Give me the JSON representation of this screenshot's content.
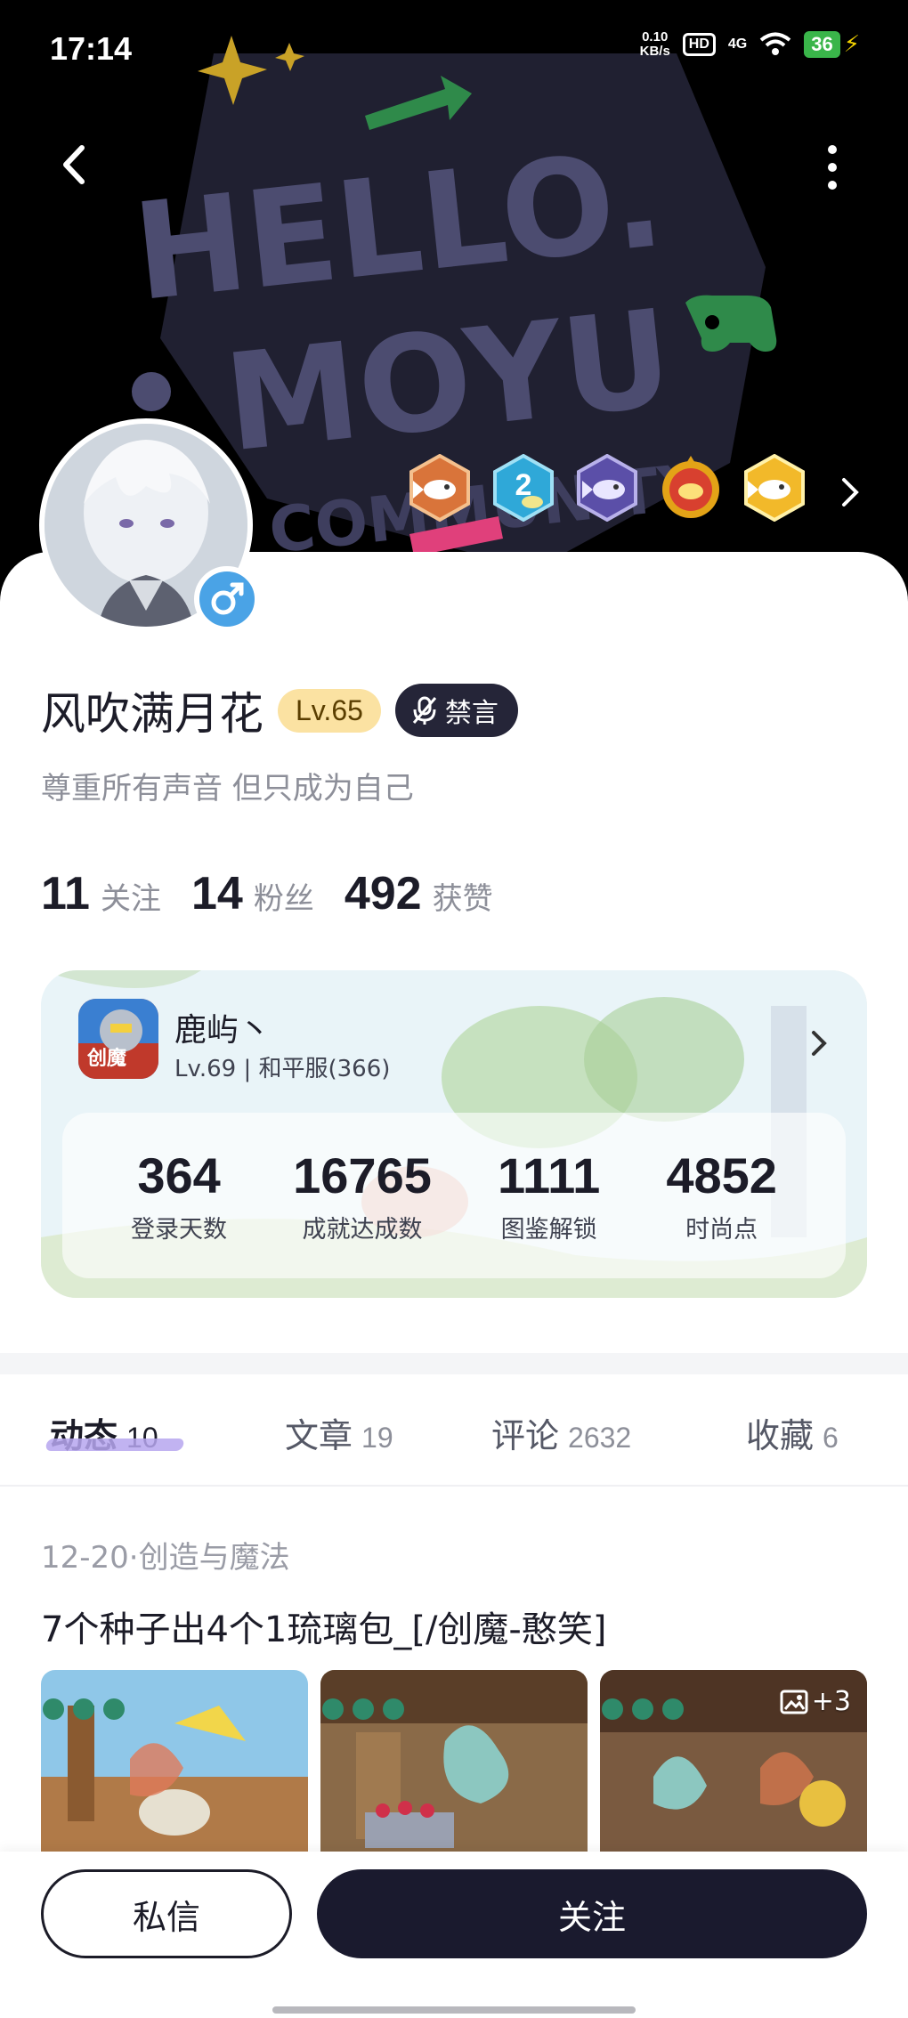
{
  "status_bar": {
    "time": "17:14",
    "net_speed_value": "0.10",
    "net_speed_unit": "KB/s",
    "hd": "HD",
    "network": "4G",
    "battery": "36"
  },
  "header": {
    "banner_text_line1": "HELLO.",
    "banner_text_line2": "MOYU",
    "banner_text_line3": "COMMUNITY"
  },
  "badges": [
    "fish-bronze-badge",
    "fish-level2-badge",
    "fish-purple-badge",
    "fish-red-badge",
    "fish-gold-badge"
  ],
  "profile": {
    "username": "风吹满月花",
    "level": "Lv.65",
    "muted_label": "禁言",
    "bio": "尊重所有声音 但只成为自己",
    "gender": "male"
  },
  "stats": [
    {
      "value": "11",
      "label": "关注"
    },
    {
      "value": "14",
      "label": "粉丝"
    },
    {
      "value": "492",
      "label": "获赞"
    }
  ],
  "game_card": {
    "name": "鹿屿丶",
    "sub": "Lv.69 | 和平服(366)",
    "stats": [
      {
        "value": "364",
        "label": "登录天数"
      },
      {
        "value": "16765",
        "label": "成就达成数"
      },
      {
        "value": "1111",
        "label": "图鉴解锁"
      },
      {
        "value": "4852",
        "label": "时尚点"
      }
    ]
  },
  "tabs": [
    {
      "label": "动态",
      "count": "10",
      "active": true
    },
    {
      "label": "文章",
      "count": "19"
    },
    {
      "label": "评论",
      "count": "2632"
    },
    {
      "label": "收藏",
      "count": "6"
    }
  ],
  "post": {
    "meta": "12-20·创造与魔法",
    "title": "7个种子出4个1琉璃包_[/创魔-憨笑]",
    "more_photos": "+3"
  },
  "bottom": {
    "dm_label": "私信",
    "follow_label": "关注"
  },
  "colors": {
    "accent_dark": "#1a1a2e",
    "level_bg": "#fbe2a2",
    "gender_blue": "#4aa3e6",
    "tab_underline": "#b6a6ef"
  }
}
